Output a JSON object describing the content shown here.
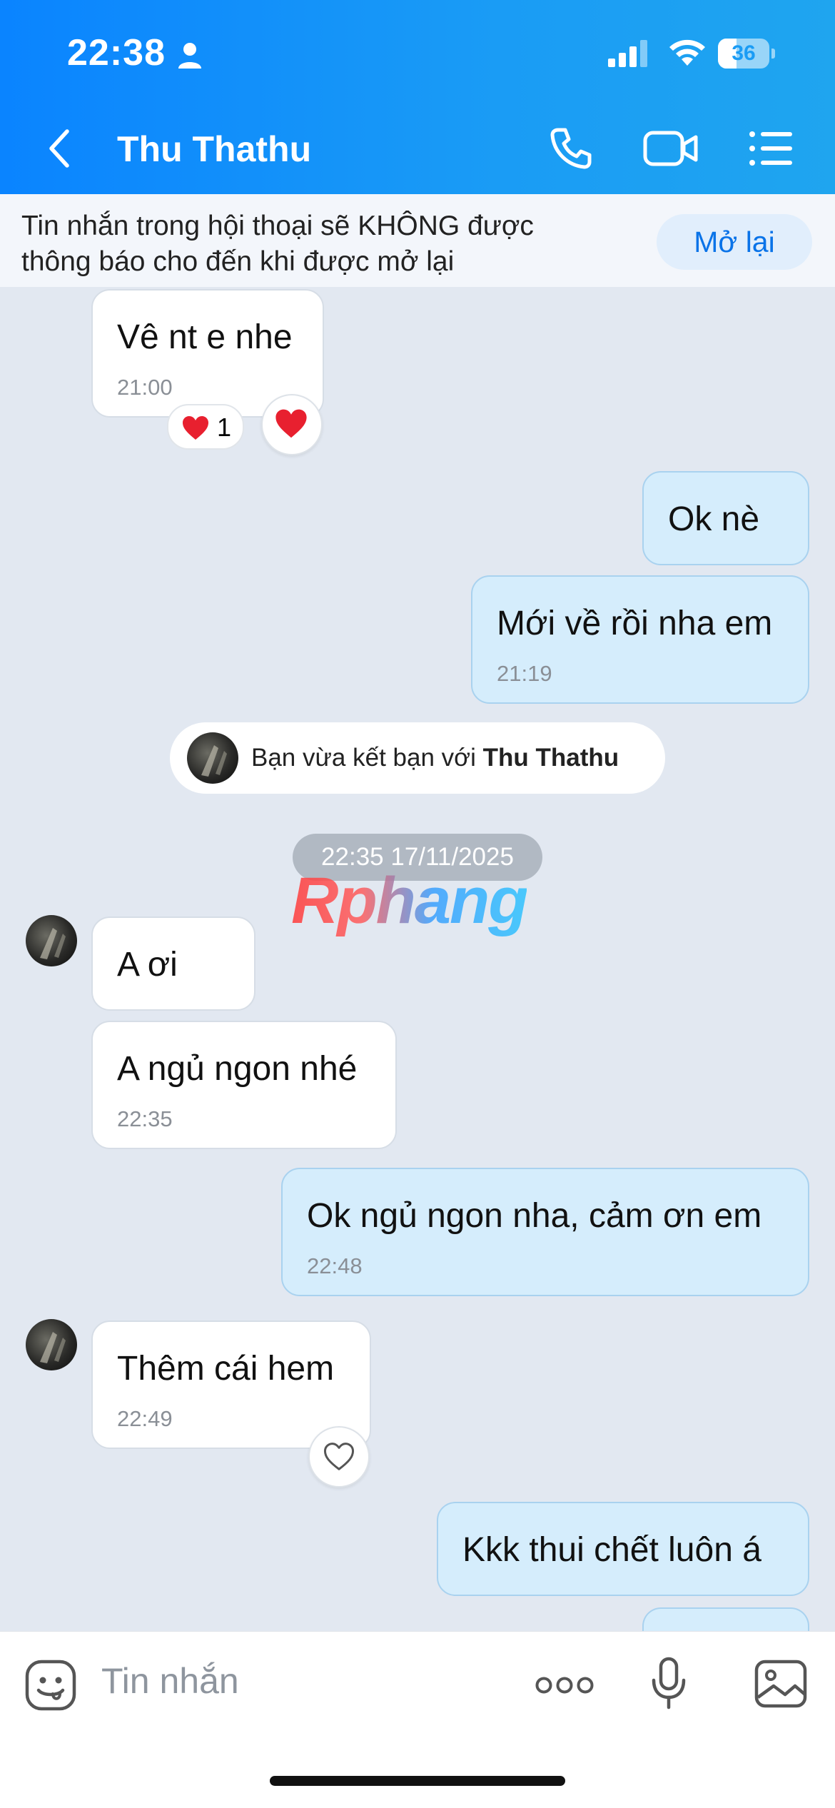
{
  "status_bar": {
    "time": "22:38",
    "battery": "36",
    "battery_level": 0.36
  },
  "header": {
    "title": "Thu Thathu"
  },
  "notice": {
    "text": "Tin nhắn trong hội thoại sẽ KHÔNG được thông báo cho đến khi được mở lại",
    "button_label": "Mở lại"
  },
  "messages": [
    {
      "text": "Vê nt e nhe",
      "time": "21:00",
      "reaction_count": "1"
    },
    {
      "text": "Ok nè"
    },
    {
      "text": "Mới về rồi nha em",
      "time": "21:19"
    },
    {
      "text": "A ơi"
    },
    {
      "text": "A ngủ ngon nhé",
      "time": "22:35"
    },
    {
      "text": "Ok ngủ ngon nha, cảm ơn em",
      "time": "22:48"
    },
    {
      "text": "Thêm cái hem",
      "time": "22:49"
    },
    {
      "text": "Kkk thui chết luôn á"
    }
  ],
  "system_message": {
    "prefix": "Bạn vừa kết bạn với ",
    "name": "Thu Thathu"
  },
  "date_separator": "22:35 17/11/2025",
  "watermark": "Rphang",
  "composer": {
    "placeholder": "Tin nhắn"
  },
  "colors": {
    "header": "#0a84ff",
    "outgoing_bubble": "#d5edfc",
    "incoming_bubble": "#ffffff",
    "background": "#e2e8f1"
  }
}
